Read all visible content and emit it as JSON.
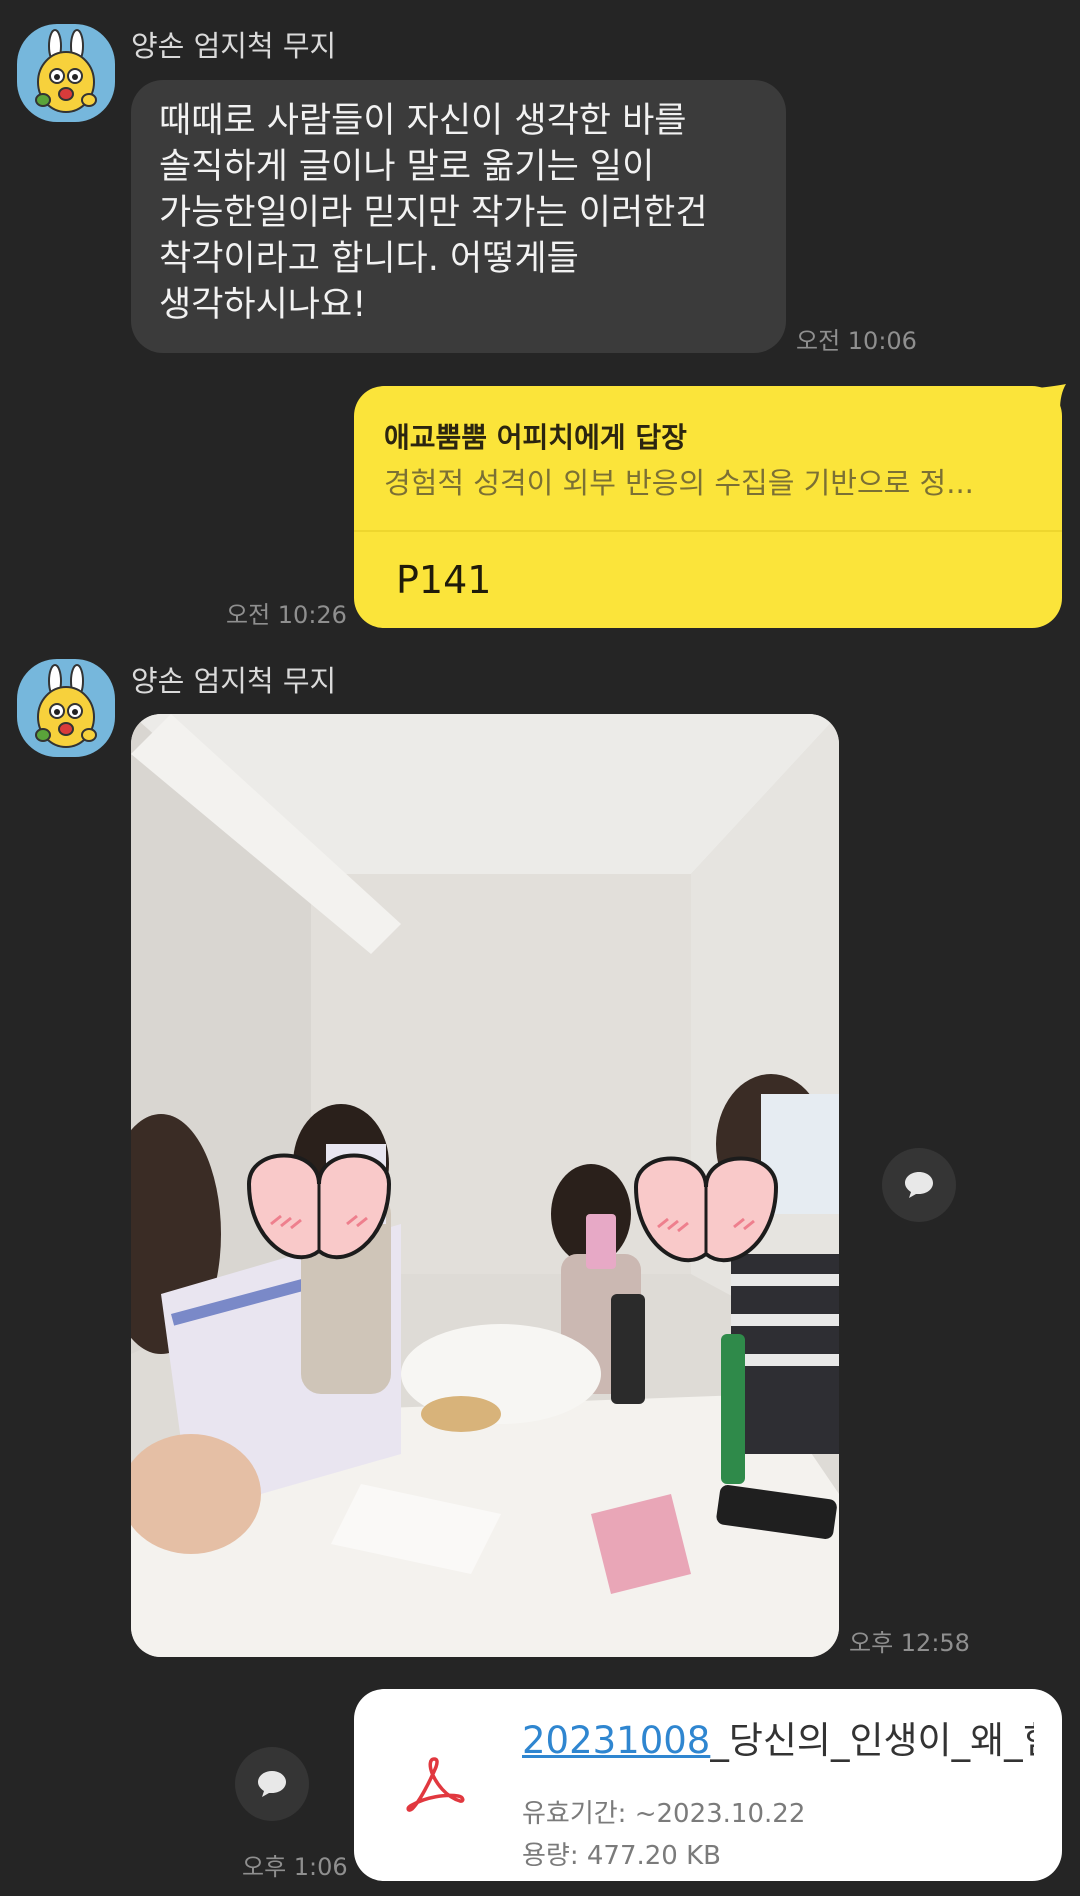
{
  "messages": {
    "first": {
      "sender": "양손 엄지척 무지",
      "lines": [
        "때때로 사람들이 자신이 생각한 바를",
        "솔직하게 글이나 말로 옮기는 일이",
        "가능한일이라 믿지만 작가는 이러한건",
        "착각이라고 합니다. 어떻게들",
        "생각하시나요!"
      ],
      "time": "오전 10:06"
    },
    "reply": {
      "title": "애교뿜뿜 어피치에게 답장",
      "quote": "경험적 성격이 외부 반응의 수집을 기반으로 정...",
      "body": "P141",
      "time": "오전 10:26"
    },
    "photo": {
      "sender": "양손 엄지척 무지",
      "time": "오후 12:58"
    },
    "file": {
      "name_link": "20231008",
      "name_rest": "_당신의_인생이_왜_힘",
      "expiry": "유효기간: ~2023.10.22",
      "size": "용량: 477.20 KB",
      "time": "오후 1:06"
    }
  },
  "colors": {
    "background": "#252525",
    "received_bubble": "#3b3b3b",
    "sent_bubble": "#fbe43a",
    "avatar_bg": "#76b7dc",
    "pdf_icon": "#e1383f",
    "link": "#2f86d0"
  },
  "icons": {
    "avatar": "muzi-character-icon",
    "share": "speech-bubble-share-icon",
    "file": "pdf-acrobat-icon"
  }
}
